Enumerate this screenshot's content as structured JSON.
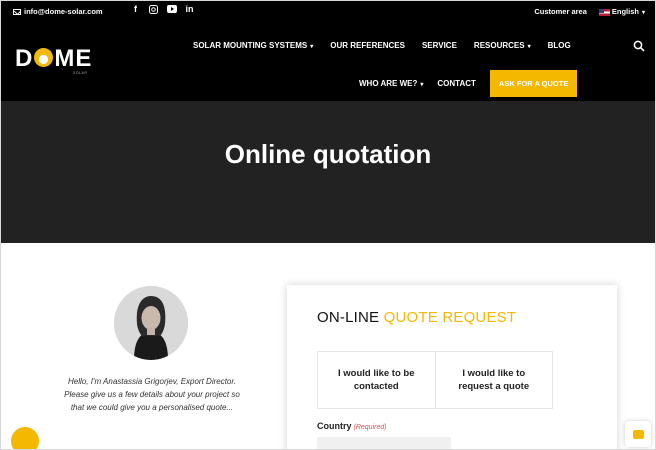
{
  "topbar": {
    "email": "info@dome-solar.com",
    "social_icons": [
      "facebook-icon",
      "instagram-icon",
      "youtube-icon",
      "linkedin-icon"
    ],
    "customer_area": "Customer area",
    "language": "English"
  },
  "header": {
    "logo_text_left": "D",
    "logo_text_right": "ME",
    "logo_sub": "SOLAR",
    "nav": {
      "solar_mounting": "SOLAR MOUNTING SYSTEMS",
      "references": "OUR REFERENCES",
      "service": "SERVICE",
      "resources": "RESOURCES",
      "blog": "BLOG",
      "who_are_we": "WHO ARE WE?",
      "contact": "CONTACT",
      "ask_quote": "ASK FOR A QUOTE"
    }
  },
  "hero": {
    "title": "Online quotation"
  },
  "intro": {
    "text": "Hello, I'm Anastassia Grigorjev, Export Director. Please give us a few details about your project so that we could give you a personalised quote..."
  },
  "form": {
    "title_main": "ON-LINE ",
    "title_accent": "QUOTE REQUEST",
    "option_contact": "I would like to be contacted",
    "option_quote": "I would like to request a quote",
    "country_label": "Country",
    "country_required": "(Required)"
  },
  "colors": {
    "accent": "#f5b800",
    "header_bg": "#000000",
    "hero_bg": "#222222"
  }
}
